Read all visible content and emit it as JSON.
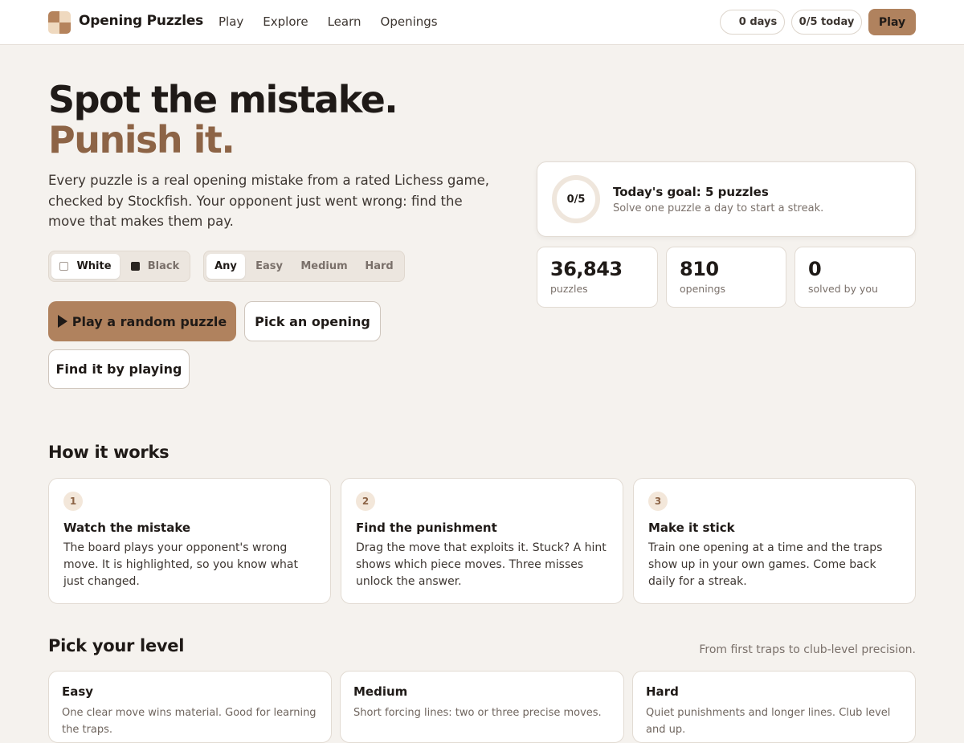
{
  "header": {
    "brand": "Opening Puzzles",
    "nav": [
      "Play",
      "Explore",
      "Learn",
      "Openings"
    ],
    "streak_label": "0 days",
    "today_label": "0/5 today",
    "play_button": "Play"
  },
  "hero": {
    "title_line1": "Spot the mistake.",
    "title_line2": "Punish it.",
    "intro": "Every puzzle is a real opening mistake from a rated Lichess game, checked by Stockfish. Your opponent just went wrong: find the move that makes them pay.",
    "color_options": [
      "White",
      "Black"
    ],
    "color_selected": "White",
    "difficulty_options": [
      "Any",
      "Easy",
      "Medium",
      "Hard"
    ],
    "difficulty_selected": "Any",
    "primary_button": "Play a random puzzle",
    "pick_button": "Pick an opening",
    "find_button": "Find it by playing"
  },
  "goal": {
    "progress_text": "0/5",
    "progress": 0,
    "title": "Today's goal: 5 puzzles",
    "subtitle": "Solve one puzzle a day to start a streak."
  },
  "stats": [
    {
      "value": "36,843",
      "label": "puzzles"
    },
    {
      "value": "810",
      "label": "openings"
    },
    {
      "value": "0",
      "label": "solved by you"
    }
  ],
  "how": {
    "title": "How it works",
    "steps": [
      {
        "num": "1",
        "title": "Watch the mistake",
        "body": "The board plays your opponent's wrong move. It is highlighted, so you know what just changed."
      },
      {
        "num": "2",
        "title": "Find the punishment",
        "body": "Drag the move that exploits it. Stuck? A hint shows which piece moves. Three misses unlock the answer."
      },
      {
        "num": "3",
        "title": "Make it stick",
        "body": "Train one opening at a time and the traps show up in your own games. Come back daily for a streak."
      }
    ]
  },
  "levels": {
    "title": "Pick your level",
    "subtitle": "From first traps to club-level precision.",
    "items": [
      {
        "name": "Easy",
        "desc": "One clear move wins material. Good for learning the traps."
      },
      {
        "name": "Medium",
        "desc": "Short forcing lines: two or three precise moves."
      },
      {
        "name": "Hard",
        "desc": "Quiet punishments and longer lines. Club level and up."
      }
    ]
  },
  "colors": {
    "accent": "#b0825e",
    "accent_text": "#8d6446",
    "background": "#f5f2ee"
  }
}
